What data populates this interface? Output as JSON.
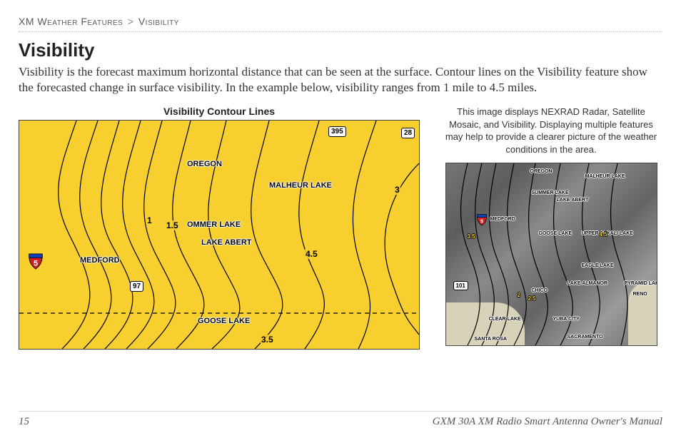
{
  "breadcrumb": {
    "section": "XM Weather Features",
    "sep": ">",
    "page": "Visibility"
  },
  "heading": "Visibility",
  "body": "Visibility is the forecast maximum horizontal distance that can be seen at the surface. Contour lines on the Visibility feature show the forecasted change in surface visibility. In the example below, visibility ranges from 1 mile to 4.5 miles.",
  "left_fig_title": "Visibility Contour Lines",
  "right_caption": "This image displays NEXRAD Radar, Satellite Mosaic, and Visibility. Displaying multiple features may help to provide a clearer picture of the weather conditions in the area.",
  "map_left": {
    "highway_395": "395",
    "route_28": "28",
    "interstate_5": "5",
    "route_97": "97",
    "labels": {
      "oregon": "OREGON",
      "malheur_lake": "MALHEUR LAKE",
      "summer_lake": "OMMER LAKE",
      "lake_abert": "LAKE ABERT",
      "medford": "MEDFORD",
      "goose_lake": "GOOSE LAKE"
    },
    "contours": {
      "v1": "1",
      "v1_5": "1.5",
      "v3": "3",
      "v3_5": "3.5",
      "v4_5": "4.5"
    }
  },
  "map_right": {
    "labels": {
      "oregon": "OREGON",
      "malheur_lake": "MALHEUR LAKE",
      "summer_lake": "SUMMER LAKE",
      "lake_abert": "LAKE ABERT",
      "medford": "MEDFORD",
      "goose_lake": "GOOSE LAKE",
      "upper_alkali": "UPPER ALKALI LAKE",
      "eagle_lake": "EAGLE LAKE",
      "lake_almanor": "LAKE ALMANOR",
      "pyramid_lake": "PYRAMID LAKE",
      "reno": "RENO",
      "chico": "CHICO",
      "clear_lake": "CLEAR LAKE",
      "yuba_city": "YUBA CITY",
      "sacramento": "SACRAMENTO",
      "santa_rosa": "SANTA ROSA"
    },
    "contours": {
      "v2": "2",
      "v2_5": "2.5",
      "v3_5": "3.5",
      "v4_5": "4.5"
    },
    "interstate_5": "5",
    "route_101": "101"
  },
  "footer": {
    "page_num": "15",
    "manual": "GXM 30A XM Radio Smart Antenna Owner's Manual"
  }
}
